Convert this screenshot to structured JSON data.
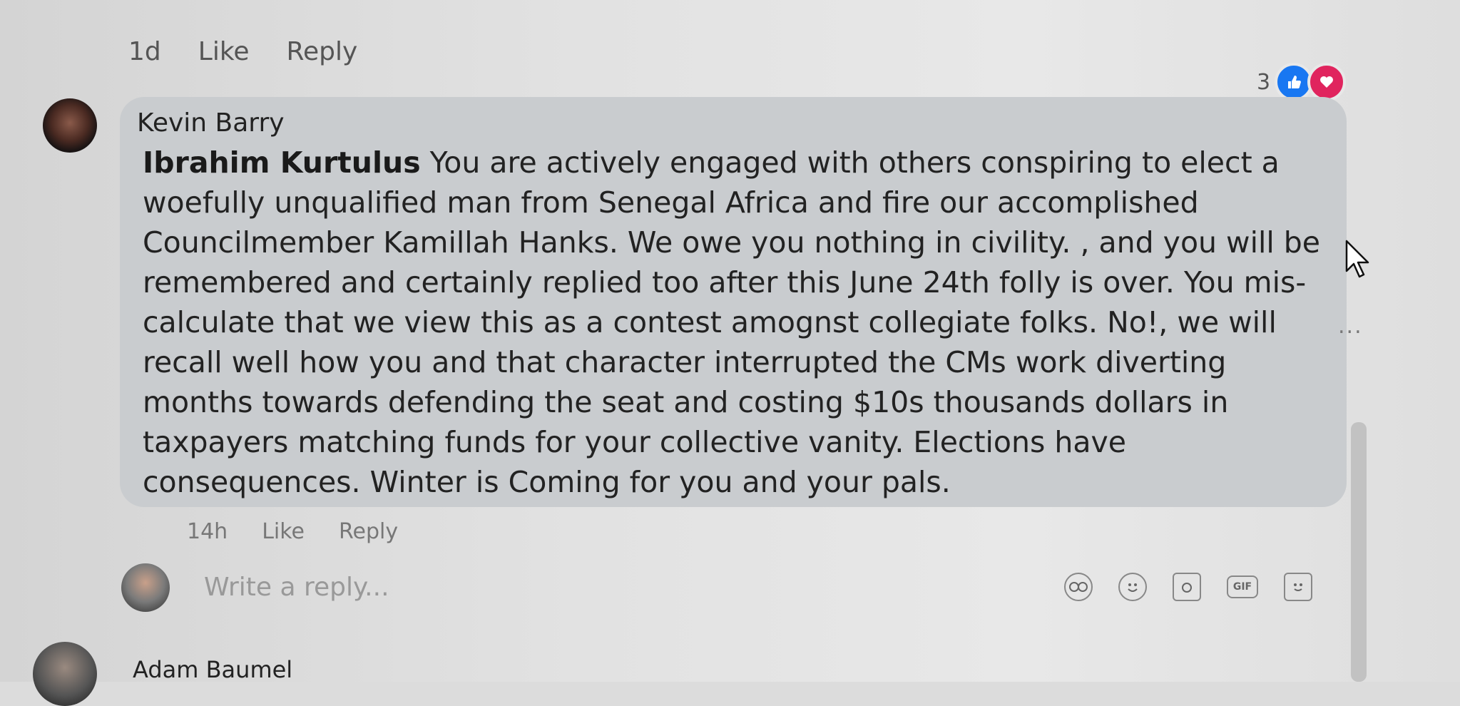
{
  "top_actions": {
    "time": "1d",
    "like": "Like",
    "reply": "Reply"
  },
  "reactions": {
    "count": "3",
    "types": [
      "like-icon",
      "love-icon"
    ],
    "colors": {
      "like": "#1877f2",
      "love": "#e0245e"
    }
  },
  "comment": {
    "author": "Kevin Barry",
    "mention": "Ibrahim Kurtulus",
    "text": " You are actively engaged with others conspiring to elect a woefully unqualified man from Senegal Africa and fire our accomplished Councilmember Kamillah Hanks. We owe you nothing in civility. , and you will be remembered and certainly replied too after this June 24th folly is over. You mis-calculate that we view this as a contest amognst collegiate folks. No!, we will recall well how you and that character interrupted the CMs work diverting months towards defending the seat and costing $10s thousands dollars in taxpayers matching funds for your collective vanity. Elections have consequences. Winter is Coming for you and your pals.",
    "time": "14h",
    "like": "Like",
    "reply": "Reply"
  },
  "reply_box": {
    "placeholder": "Write a reply...",
    "tools": [
      "avatar-sticker-icon",
      "emoji-icon",
      "camera-icon",
      "gif-icon",
      "sticker-icon"
    ],
    "gif_label": "GIF"
  },
  "next_comment": {
    "author": "Adam Baumel"
  },
  "more_label": "..."
}
